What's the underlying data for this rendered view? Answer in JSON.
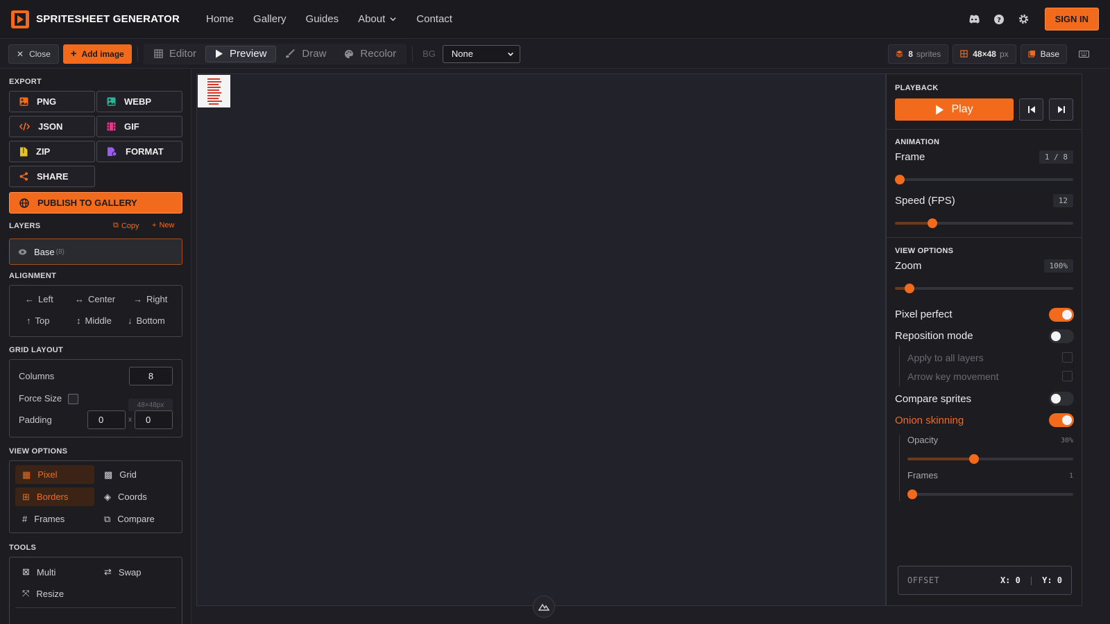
{
  "app": {
    "title": "SPRITESHEET GENERATOR",
    "accent": "#f26b1d"
  },
  "nav": {
    "links": [
      "Home",
      "Gallery",
      "Guides",
      "About",
      "Contact"
    ],
    "signin": "SIGN IN",
    "icons": [
      "discord-icon",
      "help-icon",
      "settings-icon"
    ]
  },
  "toolbar": {
    "close": "Close",
    "add_image": "Add image",
    "modes": [
      "Editor",
      "Preview",
      "Draw",
      "Recolor"
    ],
    "active_mode": "Preview",
    "bg_label": "BG",
    "bg_value": "None",
    "sprites_count": "8",
    "sprites_label": "sprites",
    "size": "48×48",
    "size_unit": "px",
    "layer": "Base"
  },
  "left": {
    "export_title": "EXPORT",
    "export_buttons": [
      "PNG",
      "WEBP",
      "JSON",
      "GIF",
      "ZIP",
      "FORMAT",
      "SHARE"
    ],
    "publish": "PUBLISH TO GALLERY",
    "layers_title": "LAYERS",
    "layers_copy": "Copy",
    "layers_new": "New",
    "layer_name": "Base",
    "layer_count": "(8)",
    "alignment_title": "ALIGNMENT",
    "alignment": [
      "Left",
      "Center",
      "Right",
      "Top",
      "Middle",
      "Bottom"
    ],
    "grid_title": "GRID LAYOUT",
    "columns_label": "Columns",
    "columns_value": "8",
    "force_size_label": "Force Size",
    "force_size_value": "48×48px",
    "padding_label": "Padding",
    "padding_x": "0",
    "padding_y": "0",
    "padding_sep": "x",
    "view_title": "VIEW OPTIONS",
    "view_options": [
      "Pixel",
      "Grid",
      "Borders",
      "Coords",
      "Frames",
      "Compare"
    ],
    "tools_title": "TOOLS",
    "tools": [
      "Multi",
      "Swap",
      "Resize"
    ]
  },
  "right": {
    "playback_title": "PLAYBACK",
    "play": "Play",
    "animation_title": "ANIMATION",
    "frame_label": "Frame",
    "frame_value": "1 / 8",
    "frame_fraction": 0.0,
    "speed_label": "Speed (FPS)",
    "speed_value": "12",
    "speed_fraction": 0.21,
    "view_title": "VIEW OPTIONS",
    "zoom_label": "Zoom",
    "zoom_value": "100%",
    "zoom_fraction": 0.08,
    "pixel_perfect": "Pixel perfect",
    "pixel_perfect_on": true,
    "reposition": "Reposition mode",
    "reposition_on": false,
    "apply_all": "Apply to all layers",
    "arrow_key": "Arrow key movement",
    "compare": "Compare sprites",
    "compare_on": false,
    "onion": "Onion skinning",
    "onion_on": true,
    "opacity_label": "Opacity",
    "opacity_value": "30%",
    "opacity_fraction": 0.4,
    "frames_label": "Frames",
    "frames_value": "1",
    "frames_fraction": 0.03,
    "offset_label": "OFFSET",
    "offset_x": "X: 0",
    "offset_y": "Y: 0",
    "offset_sep": "|"
  }
}
